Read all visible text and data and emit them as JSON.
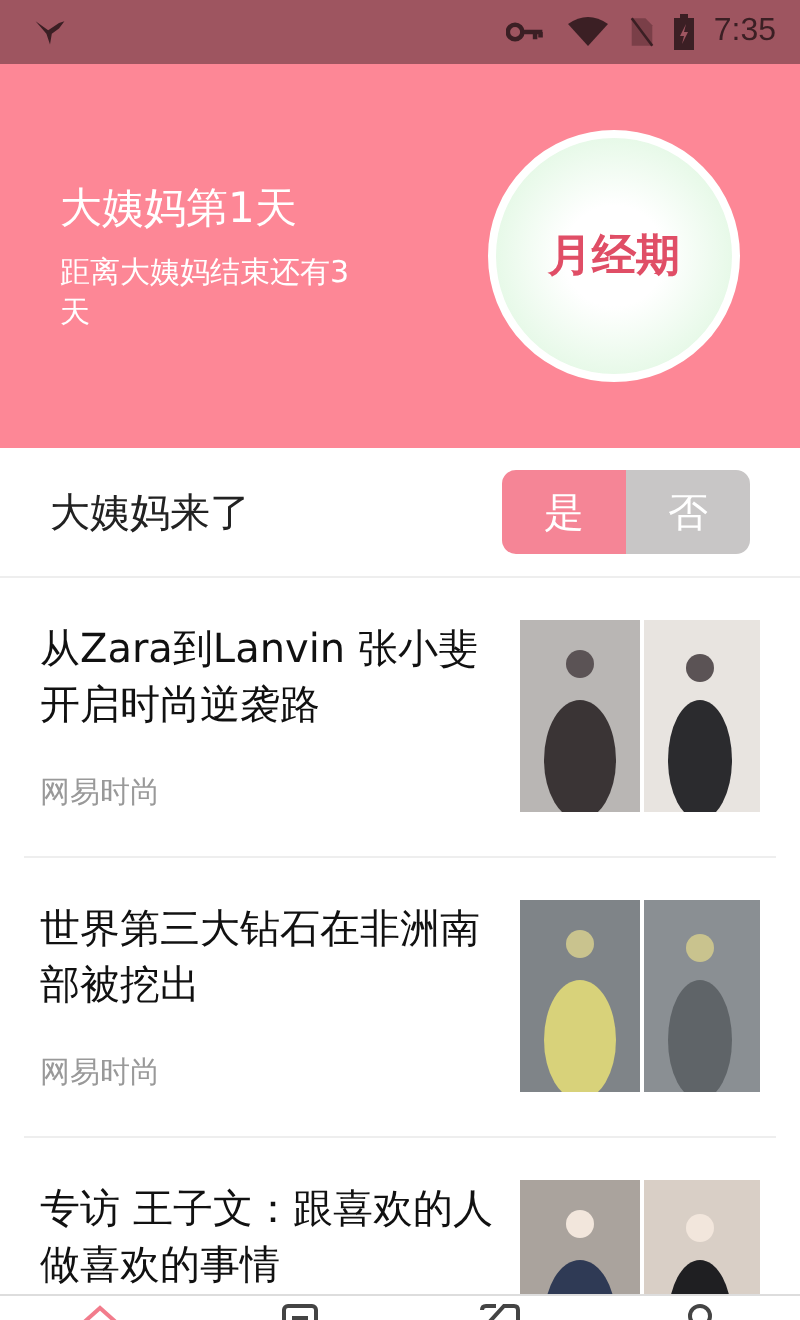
{
  "status_bar": {
    "time": "7:35"
  },
  "header": {
    "title": "大姨妈第1天",
    "subtitle": "距离大姨妈结束还有3天",
    "badge": "月经期"
  },
  "period_toggle": {
    "label": "大姨妈来了",
    "options": [
      {
        "label": "是",
        "selected": true
      },
      {
        "label": "否",
        "selected": false
      }
    ]
  },
  "articles": [
    {
      "title": "从Zara到Lanvin 张小斐开启时尚逆袭路",
      "source": "网易时尚"
    },
    {
      "title": "世界第三大钻石在非洲南部被挖出",
      "source": "网易时尚"
    },
    {
      "title": "专访 王子文：跟喜欢的人做喜欢的事情"
    }
  ],
  "bottom_nav": [
    {
      "kind": "home",
      "selected": true
    },
    {
      "kind": "notes",
      "selected": false
    },
    {
      "kind": "chat",
      "selected": false
    },
    {
      "kind": "profile",
      "selected": false
    }
  ]
}
